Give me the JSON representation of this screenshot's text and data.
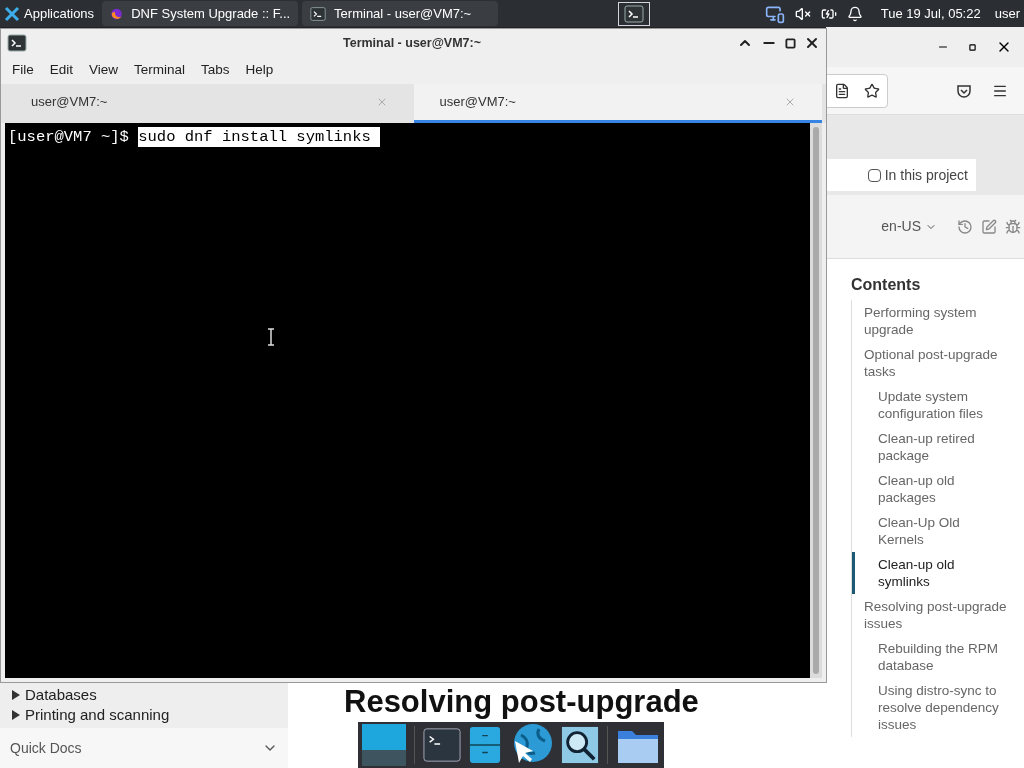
{
  "panel": {
    "apps_menu": "Applications",
    "tasks": [
      {
        "title": "DNF System Upgrade :: F...",
        "kind": "browser"
      },
      {
        "title": "Terminal - user@VM7:~",
        "kind": "terminal"
      }
    ],
    "clock": "Tue 19 Jul, 05:22",
    "user": "user"
  },
  "terminal": {
    "title": "Terminal - user@VM7:~",
    "menu": [
      "File",
      "Edit",
      "View",
      "Terminal",
      "Tabs",
      "Help"
    ],
    "tabs": [
      {
        "label": "user@VM7:~",
        "selected": false
      },
      {
        "label": "user@VM7:~",
        "selected": true
      }
    ],
    "prompt": "[user@VM7 ~]$",
    "command": "sudo dnf install symlinks",
    "command_selected": true
  },
  "browser": {
    "search_scope": {
      "label": "In this project",
      "checked": false
    },
    "language": "en-US",
    "toc": {
      "title": "Contents",
      "items": [
        {
          "label": "Performing system upgrade",
          "selected": false
        },
        {
          "label": "Optional post-upgrade tasks",
          "selected": false,
          "children": [
            {
              "label": "Update system configuration files",
              "selected": false
            },
            {
              "label": "Clean-up retired package",
              "selected": false
            },
            {
              "label": "Clean-up old packages",
              "selected": false
            },
            {
              "label": "Clean-Up Old Kernels",
              "selected": false
            },
            {
              "label": "Clean-up old symlinks",
              "selected": true
            }
          ]
        },
        {
          "label": "Resolving post-upgrade issues",
          "selected": false,
          "children": [
            {
              "label": "Rebuilding the RPM database",
              "selected": false
            },
            {
              "label": "Using distro-sync to resolve dependency issues",
              "selected": false
            }
          ]
        }
      ]
    },
    "sidebar": {
      "items": [
        "Databases",
        "Printing and scanning"
      ],
      "footer": "Quick Docs"
    },
    "heading": "Resolving post-upgrade"
  }
}
